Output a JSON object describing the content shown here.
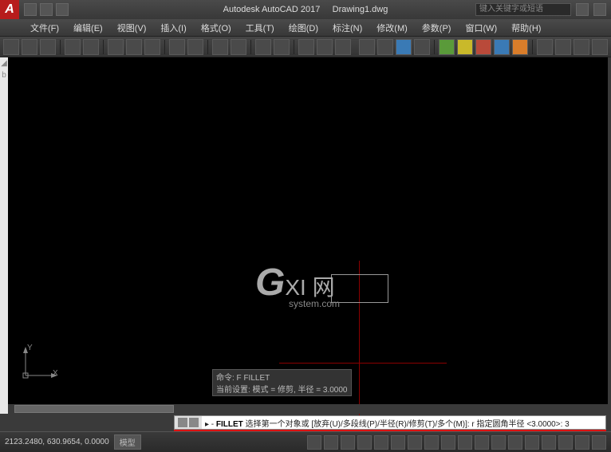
{
  "title": {
    "app": "Autodesk AutoCAD 2017",
    "file": "Drawing1.dwg"
  },
  "search_placeholder": "键入关键字或短语",
  "menus": [
    "文件(F)",
    "编辑(E)",
    "视图(V)",
    "插入(I)",
    "格式(O)",
    "工具(T)",
    "绘图(D)",
    "标注(N)",
    "修改(M)",
    "参数(P)",
    "窗口(W)",
    "帮助(H)"
  ],
  "watermark": {
    "g": "G",
    "rest": "XI 网",
    "sub": "system.com"
  },
  "ucs": {
    "x": "X",
    "y": "Y"
  },
  "cmd_history": [
    "命令: F FILLET",
    "当前设置: 模式 = 修剪, 半径 = 3.0000"
  ],
  "cmd_prompt": {
    "cmd": "FILLET",
    "text": "选择第一个对象或 [放弃(U)/多段线(P)/半径(R)/修剪(T)/多个(M)]: r 指定圆角半径 <3.0000>: 3"
  },
  "status": {
    "coords": "2123.2480, 630.9654, 0.0000",
    "model": "模型"
  }
}
